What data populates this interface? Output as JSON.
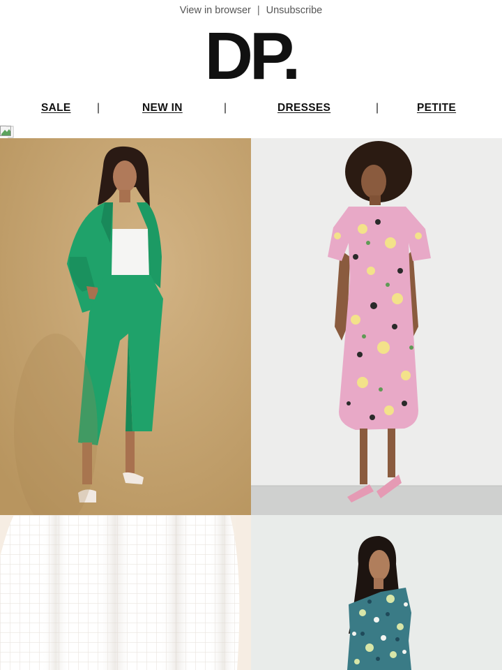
{
  "header": {
    "view_in_browser": "View in browser",
    "separator": "|",
    "unsubscribe": "Unsubscribe"
  },
  "brand": {
    "logo": "DP."
  },
  "nav": {
    "items": [
      {
        "label": "SALE"
      },
      {
        "label": "NEW IN"
      },
      {
        "label": "DRESSES"
      },
      {
        "label": "PETITE"
      }
    ],
    "divider": "|"
  },
  "products": [
    {
      "image": "model-in-green-suit"
    },
    {
      "image": "model-in-floral-midi-dress"
    },
    {
      "image": "white-textured-fabric"
    },
    {
      "image": "model-in-blue-floral-dress"
    }
  ],
  "colors": {
    "beige_backdrop": "#c7a575",
    "suit_green": "#1fa26a",
    "studio_grey": "#ecebeb",
    "text_dark": "#111111"
  }
}
